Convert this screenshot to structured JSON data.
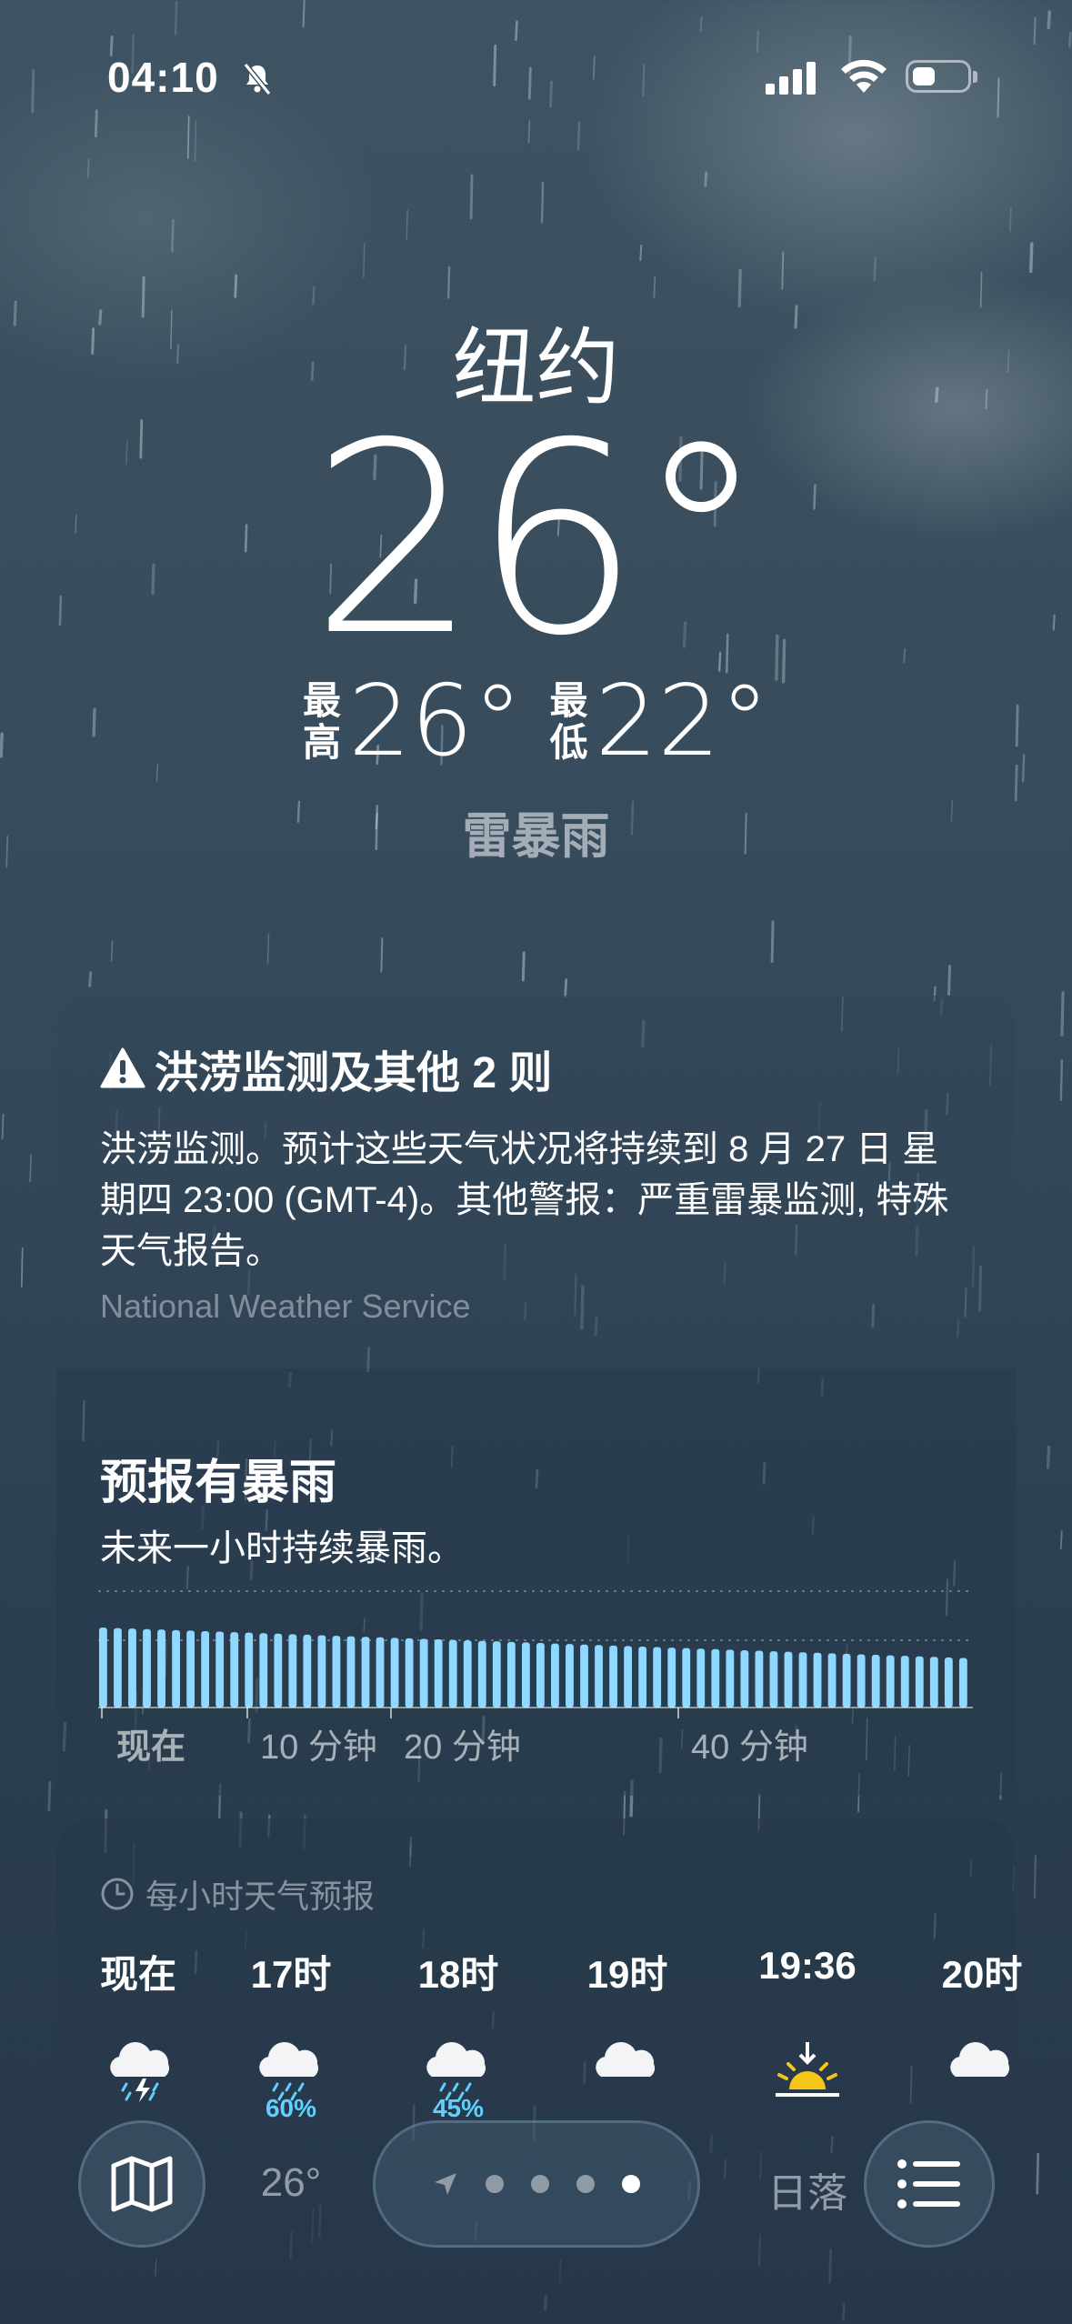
{
  "status_bar": {
    "time": "04:10"
  },
  "weather": {
    "city": "纽约",
    "temperature": "26°",
    "high_label": "最高",
    "high": "26°",
    "low_label": "最低",
    "low": "22°",
    "condition": "雷暴雨"
  },
  "alert": {
    "title": "洪涝监测及其他 2 则",
    "body": "洪涝监测。预计这些天气状况将持续到 8 月 27 日 星期四 23:00 (GMT-4)。其他警报：严重雷暴监测, 特殊天气报告。",
    "source": "National Weather Service"
  },
  "precipitation": {
    "title": "预报有暴雨",
    "subtitle": "未来一小时持续暴雨。",
    "axis_labels": [
      "现在",
      "10 分钟",
      "20 分钟",
      "40 分钟"
    ],
    "intensity_by_minute_start": 1.0,
    "intensity_by_minute_end": 0.62,
    "bar_count": 60,
    "bar_color": "#8fd8ff"
  },
  "hourly": {
    "header": "每小时天气预报",
    "items": [
      {
        "time": "现在",
        "icon": "thunderstorm-rain-icon",
        "pop": "",
        "temp": ""
      },
      {
        "time": "17时",
        "icon": "heavy-rain-icon",
        "pop": "60%",
        "temp": "26°"
      },
      {
        "time": "18时",
        "icon": "heavy-rain-icon",
        "pop": "45%",
        "temp": ""
      },
      {
        "time": "19时",
        "icon": "cloud-icon",
        "pop": "",
        "temp": ""
      },
      {
        "time": "19:36",
        "icon": "sunset-icon",
        "pop": "",
        "temp": "日落"
      },
      {
        "time": "20时",
        "icon": "cloud-icon",
        "pop": "",
        "temp": ""
      }
    ]
  },
  "page_indicator": {
    "count": 4,
    "active_index": 3
  },
  "colors": {
    "background": "#34495a",
    "accent_rain": "#5fd0ff",
    "sun": "#f5c518"
  }
}
